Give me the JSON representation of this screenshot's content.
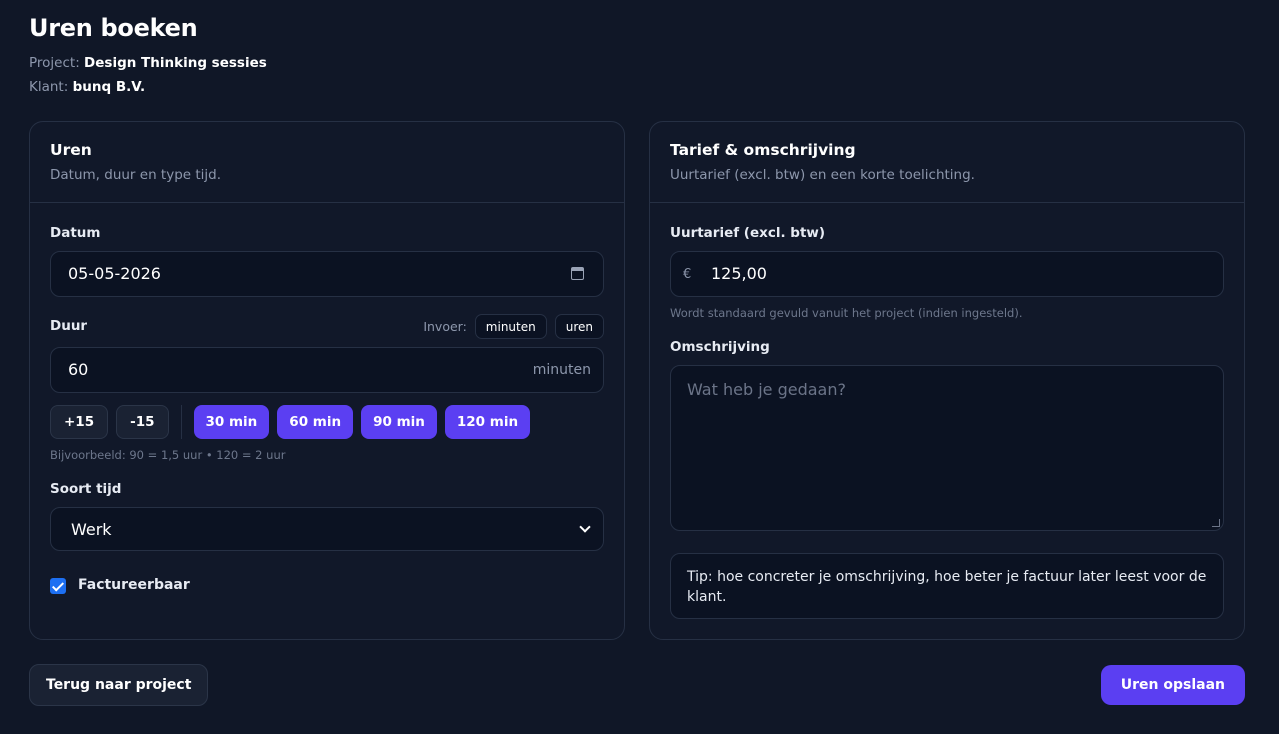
{
  "header": {
    "title": "Uren boeken",
    "project_label": "Project:",
    "project_value": "Design Thinking sessies",
    "client_label": "Klant:",
    "client_value": "bunq B.V."
  },
  "hours_card": {
    "title": "Uren",
    "subtitle": "Datum, duur en type tijd.",
    "date_label": "Datum",
    "date_value": "05-05-2026",
    "duration_label": "Duur",
    "input_mode_label": "Invoer:",
    "input_modes": [
      "minuten",
      "uren"
    ],
    "duration_value": "60",
    "duration_unit": "minuten",
    "step_buttons": [
      "+15",
      "-15"
    ],
    "preset_buttons": [
      "30 min",
      "60 min",
      "90 min",
      "120 min"
    ],
    "example_hint": "Bijvoorbeeld: 90 = 1,5 uur • 120 = 2 uur",
    "time_type_label": "Soort tijd",
    "time_type_value": "Werk",
    "billable_label": "Factureerbaar",
    "billable_checked": true
  },
  "rate_card": {
    "title": "Tarief & omschrijving",
    "subtitle": "Uurtarief (excl. btw) en een korte toelichting.",
    "rate_label": "Uurtarief (excl. btw)",
    "currency_symbol": "€",
    "rate_value": "125,00",
    "rate_hint": "Wordt standaard gevuld vanuit het project (indien ingesteld).",
    "description_label": "Omschrijving",
    "description_placeholder": "Wat heb je gedaan?",
    "tip": "Tip: hoe concreter je omschrijving, hoe beter je factuur later leest voor de klant."
  },
  "footer": {
    "back_label": "Terug naar project",
    "save_label": "Uren opslaan"
  },
  "colors": {
    "background": "#101727",
    "accent": "#5b3ff2",
    "checkbox": "#1d6ff2"
  }
}
